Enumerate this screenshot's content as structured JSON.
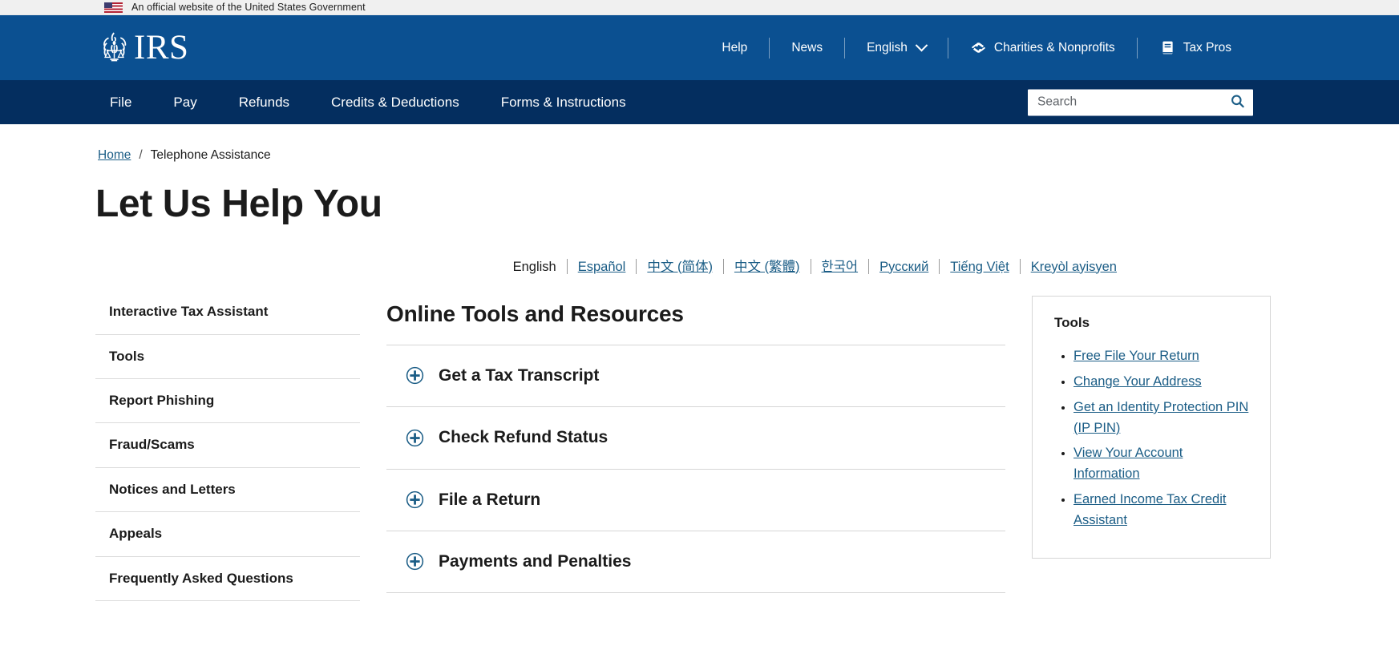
{
  "gov_banner": {
    "text": "An official website of the United States Government",
    "flag_icon": "us-flag-icon"
  },
  "header": {
    "logo_text": "IRS",
    "logo_emblem": "irs-eagle-scales-emblem",
    "utility_nav": [
      {
        "label": "Help",
        "icon": null
      },
      {
        "label": "News",
        "icon": null
      },
      {
        "label": "English",
        "icon": "chevron-down-icon"
      },
      {
        "label": "Charities & Nonprofits",
        "icon": "helping-hands-icon"
      },
      {
        "label": "Tax Pros",
        "icon": "book-icon"
      }
    ]
  },
  "primary_nav": {
    "items": [
      {
        "label": "File"
      },
      {
        "label": "Pay"
      },
      {
        "label": "Refunds"
      },
      {
        "label": "Credits & Deductions"
      },
      {
        "label": "Forms & Instructions"
      }
    ]
  },
  "search": {
    "placeholder": "Search",
    "value": "",
    "icon": "search-icon"
  },
  "breadcrumb": {
    "home": "Home",
    "separator": "/",
    "current": "Telephone Assistance"
  },
  "page": {
    "title": "Let Us Help You"
  },
  "languages": [
    {
      "label": "English",
      "current": true
    },
    {
      "label": "Español",
      "current": false
    },
    {
      "label": "中文 (简体)",
      "current": false
    },
    {
      "label": "中文 (繁體)",
      "current": false
    },
    {
      "label": "한국어",
      "current": false
    },
    {
      "label": "Русский",
      "current": false
    },
    {
      "label": "Tiếng Việt",
      "current": false
    },
    {
      "label": "Kreyòl ayisyen",
      "current": false
    }
  ],
  "side_nav": {
    "items": [
      {
        "label": "Interactive Tax Assistant"
      },
      {
        "label": "Tools"
      },
      {
        "label": "Report Phishing"
      },
      {
        "label": "Fraud/Scams"
      },
      {
        "label": "Notices and Letters"
      },
      {
        "label": "Appeals"
      },
      {
        "label": "Frequently Asked Questions"
      }
    ]
  },
  "main": {
    "section_title": "Online Tools and Resources",
    "accordion": [
      {
        "label": "Get a Tax Transcript",
        "expanded": false,
        "icon": "plus-circle-icon"
      },
      {
        "label": "Check Refund Status",
        "expanded": false,
        "icon": "plus-circle-icon"
      },
      {
        "label": "File a Return",
        "expanded": false,
        "icon": "plus-circle-icon"
      },
      {
        "label": "Payments and Penalties",
        "expanded": false,
        "icon": "plus-circle-icon"
      }
    ]
  },
  "tools_box": {
    "title": "Tools",
    "links": [
      {
        "label": "Free File Your Return"
      },
      {
        "label": "Change Your Address"
      },
      {
        "label": "Get an Identity Protection PIN (IP PIN)"
      },
      {
        "label": "View Your Account Information"
      },
      {
        "label": "Earned Income Tax Credit Assistant"
      }
    ]
  },
  "colors": {
    "header_blue": "#0b5091",
    "nav_navy": "#042e5f",
    "link_blue": "#1b5d86",
    "text_dark": "#1b1b1b",
    "banner_gray": "#f0f0f0",
    "rule_gray": "#d6d6d6"
  }
}
